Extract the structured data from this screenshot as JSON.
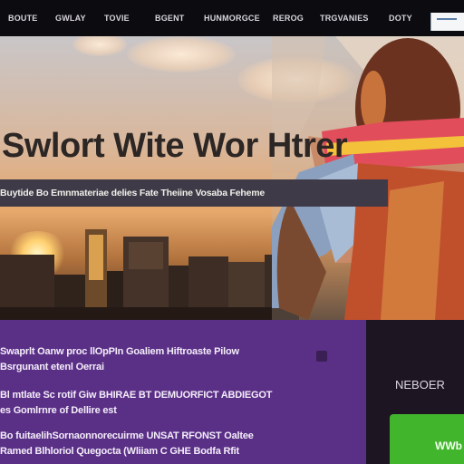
{
  "nav": {
    "items": [
      "BOUTE",
      "GWLAY",
      "TOVIE",
      "BGENT",
      "HUNMORGCE",
      "REROG",
      "TRGVANIES",
      "DOTY"
    ]
  },
  "hero": {
    "title": "Swlort Wite Wor Htrer",
    "subtitle": "Buytide Bo Emnmateriae delies Fate Theiine Vosaba Feheme"
  },
  "content": {
    "lines": [
      "Swaprlt Oanw proc llOpPIn Goaliem Hiftroaste Pilow",
      "Bsrgunant etenl Oerrai",
      "Bl mtlate Sc rotif Giw BHIRAE BT DEMUORFICT ABDIEGOT",
      "es Gomlrnre of Dellire est",
      "Bo fuitaelihSornaonnorecuirme UNSAT RFONST Oaltee",
      "Ramed Blhloriol Quegocta (Wliiam C GHE Bodfa Rfit"
    ]
  },
  "sidebar": {
    "label": "NEBOER",
    "button_label": "WWb"
  },
  "colors": {
    "nav_bg": "#0b0b10",
    "subbar_bg": "#3f3a48",
    "purple": "#5a2f86",
    "green": "#41b52c"
  }
}
